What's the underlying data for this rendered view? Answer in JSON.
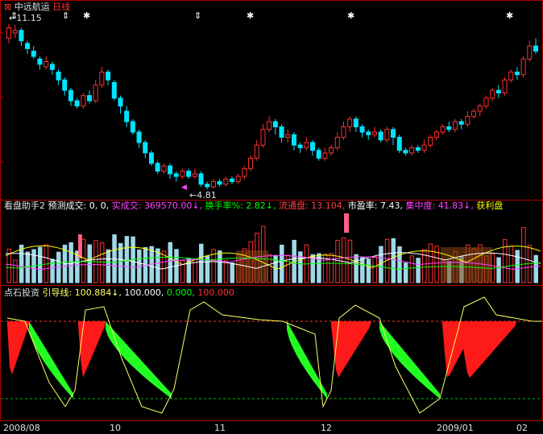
{
  "header": {
    "stock_name": "中远航运",
    "period": "日线",
    "high_marker": "11.15",
    "low_marker": "4.81",
    "colors": {
      "up": "#ff3030",
      "down": "#00e5ff",
      "border": "#b00000"
    }
  },
  "volume_panel": {
    "title": "看盘助手2",
    "items": [
      {
        "label": "预测成交:",
        "value": "0, 0,",
        "color": "#ffffff"
      },
      {
        "label": "实成交:",
        "value": "369570.00↓,",
        "color": "#ff44ff"
      },
      {
        "label": "换手率%:",
        "value": "2.82↓,",
        "color": "#00ff00"
      },
      {
        "label": "流通盘:",
        "value": "13.104,",
        "color": "#ff4040"
      },
      {
        "label": "市盈率:",
        "value": "7.43,",
        "color": "#ffffff"
      },
      {
        "label": "集中度:",
        "value": "41.83↓,",
        "color": "#ff44ff"
      },
      {
        "label": "获利盘",
        "value": "",
        "color": "#ffff00"
      }
    ]
  },
  "indicator_panel": {
    "title": "点石投资",
    "label": "引导线:",
    "values": [
      {
        "text": "100.884↓,",
        "color": "#ffff66"
      },
      {
        "text": "100.000,",
        "color": "#ffffff"
      },
      {
        "text": "0.000,",
        "color": "#00ff00"
      },
      {
        "text": "100.000",
        "color": "#ff3030"
      }
    ]
  },
  "date_axis": [
    {
      "label": "2008/08"
    },
    {
      "label": "10"
    },
    {
      "label": "11"
    },
    {
      "label": "12"
    },
    {
      "label": "2009/01"
    },
    {
      "label": "02"
    }
  ],
  "chart_data": {
    "type": "candlestick",
    "price_high": 11.15,
    "price_low": 4.81,
    "candles": [
      [
        10.6,
        11.0,
        11.15,
        10.4
      ],
      [
        10.8,
        10.9,
        11.1,
        10.6
      ],
      [
        10.9,
        10.5,
        11.0,
        10.3
      ],
      [
        10.4,
        10.2,
        10.5,
        10.0
      ],
      [
        10.1,
        9.9,
        10.3,
        9.8
      ],
      [
        9.8,
        9.6,
        9.9,
        9.4
      ],
      [
        9.5,
        9.7,
        9.9,
        9.4
      ],
      [
        9.6,
        9.4,
        9.7,
        9.2
      ],
      [
        9.3,
        9.0,
        9.4,
        8.8
      ],
      [
        9.0,
        8.6,
        9.1,
        8.4
      ],
      [
        8.6,
        8.2,
        8.7,
        8.0
      ],
      [
        8.2,
        8.0,
        8.3,
        7.9
      ],
      [
        8.0,
        8.4,
        8.5,
        7.9
      ],
      [
        8.4,
        8.2,
        8.6,
        8.1
      ],
      [
        8.2,
        8.8,
        9.0,
        8.1
      ],
      [
        8.8,
        9.3,
        9.5,
        8.7
      ],
      [
        9.3,
        9.0,
        9.4,
        8.8
      ],
      [
        8.9,
        8.3,
        9.0,
        8.2
      ],
      [
        8.3,
        8.0,
        8.4,
        7.7
      ],
      [
        7.8,
        7.4,
        8.0,
        7.2
      ],
      [
        7.4,
        7.0,
        7.5,
        6.9
      ],
      [
        7.0,
        6.6,
        7.1,
        6.4
      ],
      [
        6.6,
        6.2,
        6.7,
        6.0
      ],
      [
        6.2,
        5.8,
        6.3,
        5.7
      ],
      [
        5.8,
        5.5,
        5.9,
        5.4
      ],
      [
        5.5,
        5.7,
        5.8,
        5.4
      ],
      [
        5.7,
        5.4,
        5.8,
        5.2
      ],
      [
        5.4,
        5.3,
        5.5,
        5.1
      ],
      [
        5.3,
        5.5,
        5.6,
        5.2
      ],
      [
        5.5,
        5.3,
        5.6,
        5.2
      ],
      [
        5.3,
        5.4,
        5.6,
        5.2
      ],
      [
        5.4,
        5.0,
        5.5,
        4.9
      ],
      [
        5.0,
        4.9,
        5.1,
        4.81
      ],
      [
        4.9,
        5.1,
        5.2,
        4.85
      ],
      [
        5.1,
        5.0,
        5.2,
        4.9
      ],
      [
        5.0,
        5.2,
        5.3,
        4.9
      ],
      [
        5.2,
        5.1,
        5.3,
        5.0
      ],
      [
        5.1,
        5.3,
        5.4,
        5.0
      ],
      [
        5.3,
        5.6,
        5.7,
        5.2
      ],
      [
        5.6,
        6.0,
        6.1,
        5.5
      ],
      [
        6.0,
        6.5,
        6.7,
        5.9
      ],
      [
        6.5,
        7.1,
        7.3,
        6.4
      ],
      [
        7.1,
        7.4,
        7.6,
        7.0
      ],
      [
        7.4,
        7.2,
        7.5,
        6.9
      ],
      [
        7.2,
        6.8,
        7.3,
        6.6
      ],
      [
        6.8,
        6.9,
        7.1,
        6.6
      ],
      [
        6.9,
        6.5,
        7.0,
        6.3
      ],
      [
        6.5,
        6.4,
        6.6,
        6.2
      ],
      [
        6.4,
        6.6,
        6.8,
        6.3
      ],
      [
        6.6,
        6.3,
        6.7,
        6.1
      ],
      [
        6.3,
        6.0,
        6.4,
        5.9
      ],
      [
        6.0,
        6.2,
        6.4,
        5.9
      ],
      [
        6.2,
        6.4,
        6.5,
        6.1
      ],
      [
        6.4,
        6.8,
        7.0,
        6.3
      ],
      [
        6.8,
        7.2,
        7.4,
        6.7
      ],
      [
        7.2,
        7.5,
        7.6,
        7.0
      ],
      [
        7.5,
        7.2,
        7.6,
        7.0
      ],
      [
        7.2,
        7.0,
        7.3,
        6.8
      ],
      [
        7.0,
        6.9,
        7.1,
        6.7
      ],
      [
        6.9,
        7.0,
        7.2,
        6.8
      ],
      [
        7.0,
        6.7,
        7.1,
        6.6
      ],
      [
        6.7,
        7.1,
        7.2,
        6.6
      ],
      [
        7.1,
        6.8,
        7.2,
        6.5
      ],
      [
        6.8,
        6.3,
        6.9,
        6.2
      ],
      [
        6.3,
        6.2,
        6.4,
        6.1
      ],
      [
        6.2,
        6.4,
        6.5,
        6.1
      ],
      [
        6.4,
        6.3,
        6.5,
        6.2
      ],
      [
        6.3,
        6.5,
        6.7,
        6.2
      ],
      [
        6.5,
        6.8,
        6.9,
        6.4
      ],
      [
        6.8,
        7.0,
        7.1,
        6.7
      ],
      [
        7.0,
        7.2,
        7.3,
        6.9
      ],
      [
        7.2,
        7.1,
        7.4,
        7.0
      ],
      [
        7.1,
        7.4,
        7.5,
        7.0
      ],
      [
        7.4,
        7.3,
        7.5,
        7.1
      ],
      [
        7.3,
        7.6,
        7.8,
        7.2
      ],
      [
        7.6,
        7.8,
        7.9,
        7.5
      ],
      [
        7.8,
        8.0,
        8.1,
        7.6
      ],
      [
        8.0,
        8.3,
        8.4,
        7.9
      ],
      [
        8.3,
        8.6,
        8.7,
        8.2
      ],
      [
        8.6,
        8.5,
        8.8,
        8.3
      ],
      [
        8.5,
        9.0,
        9.1,
        8.4
      ],
      [
        9.0,
        9.3,
        9.4,
        8.9
      ],
      [
        9.3,
        9.2,
        9.5,
        9.0
      ],
      [
        9.2,
        9.8,
        9.9,
        9.1
      ],
      [
        9.8,
        10.3,
        10.5,
        9.7
      ],
      [
        10.3,
        10.1,
        10.6,
        10.0
      ]
    ],
    "volume_panel_series": "volume bars with moving averages",
    "indicator_reference_lines": [
      100,
      0
    ]
  }
}
